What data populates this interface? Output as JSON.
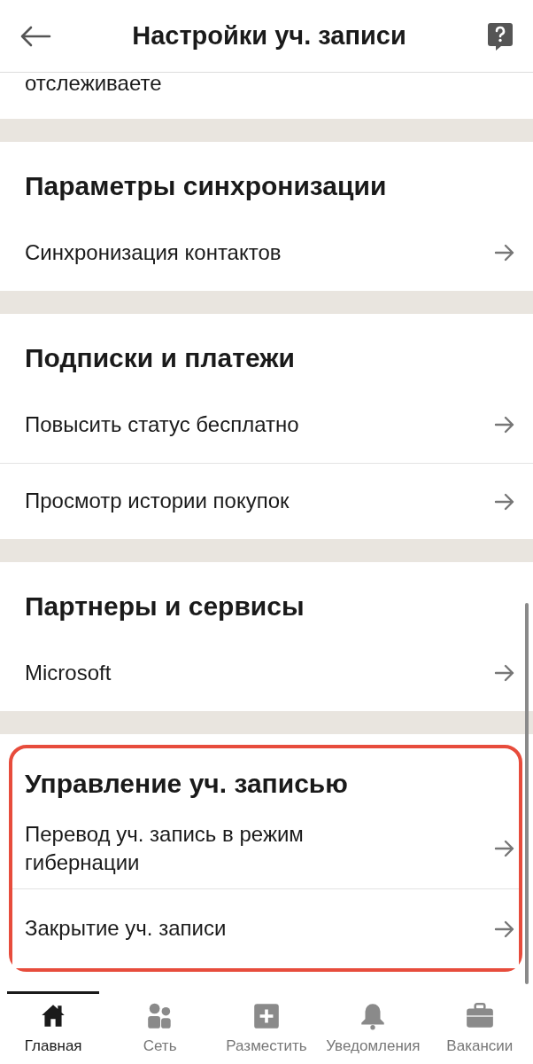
{
  "header": {
    "title": "Настройки уч. записи"
  },
  "partial_text": "отслеживаете",
  "sections": [
    {
      "title": "Параметры синхронизации",
      "highlighted": false,
      "items": [
        {
          "label": "Синхронизация контактов"
        }
      ]
    },
    {
      "title": "Подписки и платежи",
      "highlighted": false,
      "items": [
        {
          "label": "Повысить статус бесплатно"
        },
        {
          "label": "Просмотр истории покупок"
        }
      ]
    },
    {
      "title": "Партнеры и сервисы",
      "highlighted": false,
      "items": [
        {
          "label": "Microsoft"
        }
      ]
    },
    {
      "title": "Управление уч. записью",
      "highlighted": true,
      "items": [
        {
          "label": "Перевод уч. запись в режим гибернации"
        },
        {
          "label": "Закрытие уч. записи"
        }
      ]
    }
  ],
  "nav": [
    {
      "label": "Главная",
      "selected": true
    },
    {
      "label": "Сеть",
      "selected": false
    },
    {
      "label": "Разместить",
      "selected": false
    },
    {
      "label": "Уведомления",
      "selected": false
    },
    {
      "label": "Вакансии",
      "selected": false
    }
  ]
}
